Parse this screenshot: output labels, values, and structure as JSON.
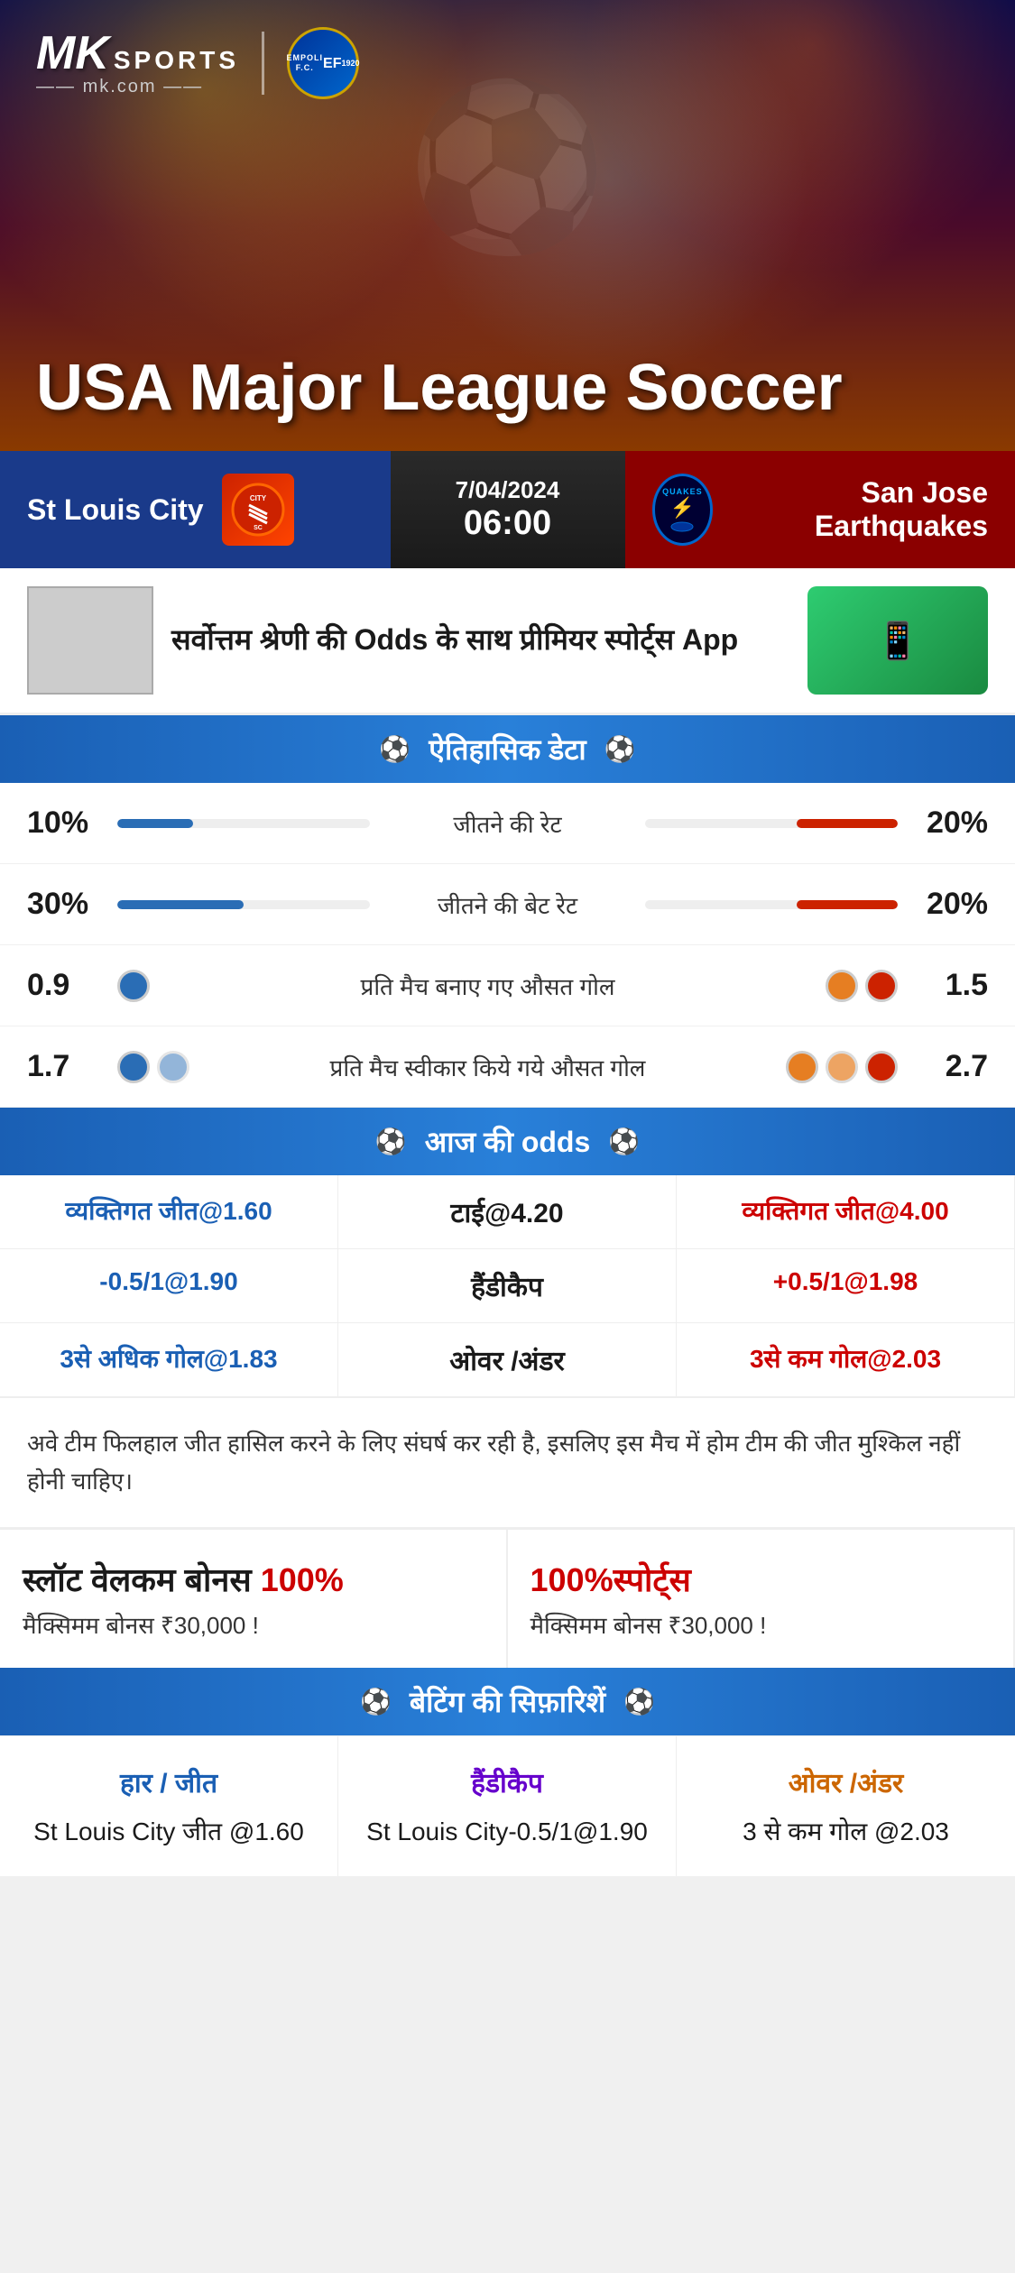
{
  "brand": {
    "name_mk": "MK",
    "name_sports": "SPORTS",
    "domain": "mk.com",
    "partner": "EMPOLI F.C.",
    "partner_year": "1920"
  },
  "banner": {
    "title": "USA Major League Soccer"
  },
  "match": {
    "home_team": "St Louis City",
    "away_team": "San Jose Earthquakes",
    "away_team_short": "QUAKES",
    "date": "7/04/2024",
    "time": "06:00"
  },
  "app_promo": {
    "text": "सर्वोत्तम श्रेणी की Odds के साथ प्रीमियर स्पोर्ट्स App"
  },
  "historical": {
    "section_title": "ऐतिहासिक डेटा",
    "rows": [
      {
        "label": "जीतने की रेट",
        "left_value": "10%",
        "right_value": "20%",
        "left_bar_width": "30%",
        "right_bar_width": "40%"
      },
      {
        "label": "जीतने की बेट रेट",
        "left_value": "30%",
        "right_value": "20%",
        "left_bar_width": "50%",
        "right_bar_width": "40%"
      },
      {
        "label": "प्रति मैच बनाए गए औसत गोल",
        "left_value": "0.9",
        "right_value": "1.5",
        "left_icons": 1,
        "right_icons": 2
      },
      {
        "label": "प्रति मैच स्वीकार किये गये औसत गोल",
        "left_value": "1.7",
        "right_value": "2.7",
        "left_icons": 2,
        "right_icons": 3
      }
    ]
  },
  "odds": {
    "section_title": "आज की odds",
    "rows": [
      {
        "left": "व्यक्तिगत जीत@1.60",
        "center": "टाई@4.20",
        "right": "व्यक्तिगत जीत@4.00",
        "center_label": ""
      },
      {
        "left": "-0.5/1@1.90",
        "center": "हैंडीकैप",
        "right": "+0.5/1@1.98",
        "center_label": "हैंडीकैप"
      },
      {
        "left": "3से अधिक गोल@1.83",
        "center": "ओवर /अंडर",
        "right": "3से कम गोल@2.03",
        "center_label": "ओवर /अंडर"
      }
    ]
  },
  "note": {
    "text": "अवे टीम फिलहाल जीत हासिल करने के लिए संघर्ष कर रही है, इसलिए इस मैच में होम टीम की जीत मुश्किल नहीं होनी चाहिए।"
  },
  "bonus": {
    "left": {
      "title": "स्लॉट वेलकम बोनस",
      "percent": "100%",
      "subtitle": "मैक्सिमम बोनस ₹30,000  !"
    },
    "right": {
      "title": "100%स्पोर्ट्स",
      "subtitle": "मैक्सिमम बोनस  ₹30,000 !"
    }
  },
  "betting": {
    "section_title": "बेटिंग की सिफ़ारिशें",
    "cols": [
      {
        "header": "हार / जीत",
        "color": "blue",
        "value": "St Louis City जीत @1.60"
      },
      {
        "header": "हैंडीकैप",
        "color": "purple",
        "value": "St Louis City-0.5/1@1.90"
      },
      {
        "header": "ओवर /अंडर",
        "color": "orange",
        "value": "3 से कम गोल @2.03"
      }
    ]
  }
}
